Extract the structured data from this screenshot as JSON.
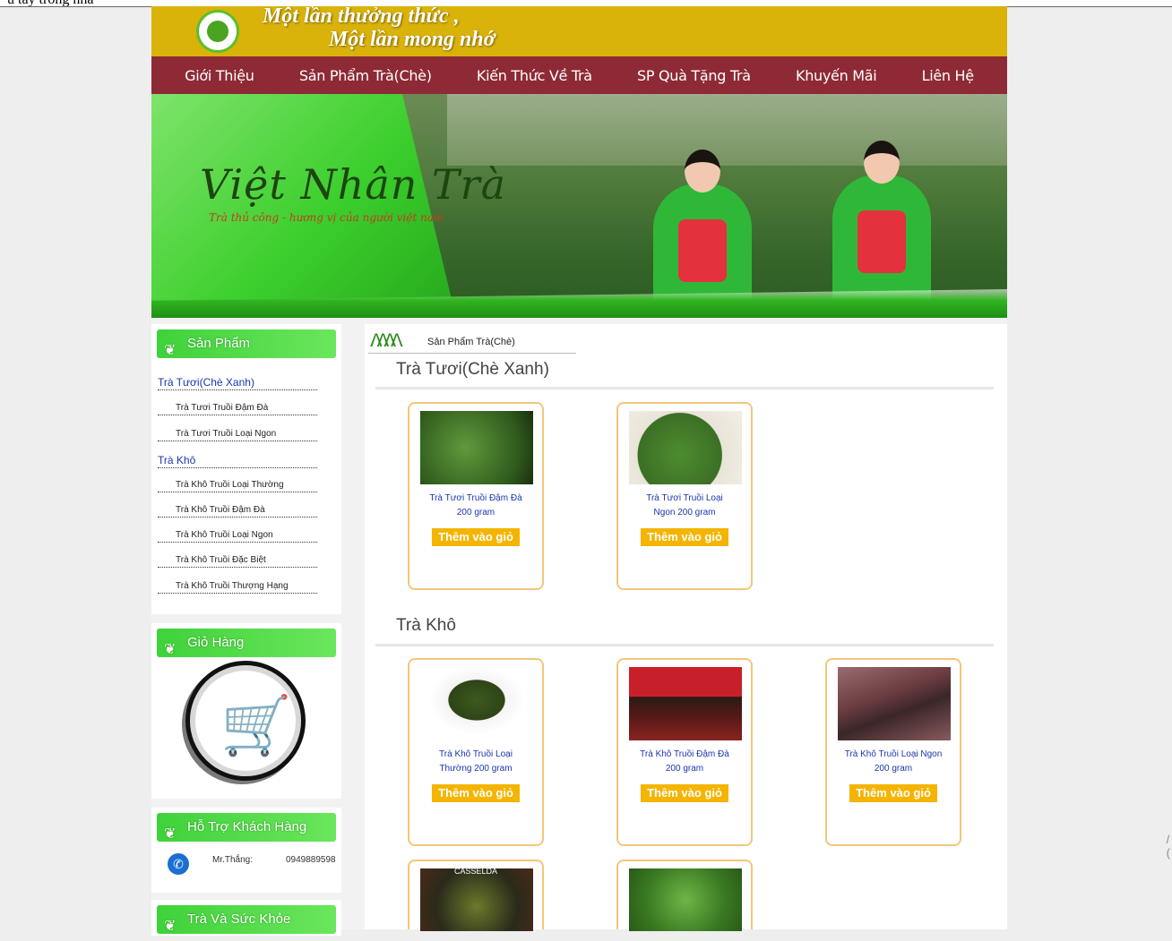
{
  "top_text": "u tay trong nhà",
  "header": {
    "slogan_line1": "Một lần thưởng thức ,",
    "slogan_line2": "Một lần mong nhớ"
  },
  "nav": [
    "Giới Thiệu",
    "Sản Phẩm Trà(Chè)",
    "Kiến Thức Về Trà",
    "SP Quà Tặng Trà",
    "Khuyến Mãi",
    "Liên Hệ"
  ],
  "banner": {
    "title": "Việt Nhân Trà",
    "subtitle": "Trà thủ công - hương vị của người việt nam"
  },
  "sidebar": {
    "products_title": "Sản Phẩm",
    "categories": [
      {
        "label": "Trà Tươi(Chè Xanh)",
        "items": [
          "Trà Tươi Truồi Đậm Đà",
          "Trà Tươi Truồi Loại Ngon"
        ]
      },
      {
        "label": "Trà Khô",
        "items": [
          "Trà Khô Truồi Loại Thường",
          "Trà Khô Truồi Đậm Đà",
          "Trà Khô Truồi Loại Ngon",
          "Trà Khô Truồi Đặc Biệt",
          "Trà Khô Truồi Thượng Hạng"
        ]
      }
    ],
    "cart_title": "Giỏ Hàng",
    "support_title": "Hỗ Trợ Khách Hàng",
    "support_name": "Mr.Thắng:",
    "support_phone": "0949889598",
    "health_title": "Trà Và Sức Khỏe"
  },
  "main": {
    "breadcrumb": "Sản Phẩm Trà(Chè)",
    "add_label": "Thêm vào giỏ",
    "sections": [
      {
        "title": "Trà Tươi(Chè Xanh)",
        "products": [
          {
            "name_l1": "Trà Tươi Truồi Đậm Đà",
            "name_l2": "200 gram"
          },
          {
            "name_l1": "Trà Tươi Truồi Loại",
            "name_l2": "Ngon 200 gram"
          }
        ]
      },
      {
        "title": "Trà Khô",
        "products": [
          {
            "name_l1": "Trà Khô Truồi Loại",
            "name_l2": "Thường 200 gram"
          },
          {
            "name_l1": "Trà Khô Truồi Đậm Đà",
            "name_l2": "200 gram"
          },
          {
            "name_l1": "Trà Khô Truồi Loại Ngon",
            "name_l2": "200 gram"
          }
        ]
      }
    ],
    "overlay_text": "CASSELDA"
  },
  "colors": {
    "header": "#d9b30a",
    "nav": "#8e2a35",
    "sidebar_head": "#4bdc3f",
    "button": "#f4b400",
    "card_border": "#f2c67c"
  }
}
